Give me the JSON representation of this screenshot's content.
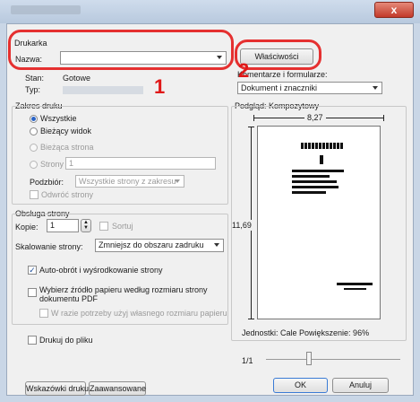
{
  "window": {
    "close_glyph": "x"
  },
  "printer": {
    "group_label": "Drukarka",
    "name_label": "Nazwa:",
    "status_label": "Stan:",
    "status_value": "Gotowe",
    "type_label": "Typ:",
    "properties_button": "Właściwości"
  },
  "comments": {
    "label": "Komentarze i formularze:",
    "selected": "Dokument i znaczniki"
  },
  "range": {
    "group_label": "Zakres druku",
    "all": "Wszystkie",
    "current_view": "Bieżący widok",
    "current_page": "Bieżąca strona",
    "pages": "Strony",
    "pages_value": "1",
    "subset_label": "Podzbiór:",
    "subset_value": "Wszystkie strony z zakresu",
    "reverse": "Odwróć strony"
  },
  "handling": {
    "group_label": "Obsługa strony",
    "copies_label": "Kopie:",
    "copies_value": "1",
    "collate": "Sortuj",
    "scaling_label": "Skalowanie strony:",
    "scaling_value": "Zmniejsz do obszaru zadruku",
    "auto_rotate": "Auto-obrót i wyśrodkowanie strony",
    "paper_source_line1": "Wybierz źródło papieru według rozmiaru strony",
    "paper_source_line2": "dokumentu PDF",
    "custom_size": "W razie potrzeby użyj własnego rozmiaru papieru"
  },
  "print_to_file": "Drukuj do pliku",
  "preview": {
    "label": "Podgląd: Kompozytowy",
    "width": "8,27",
    "height": "11,69",
    "units": "Jednostki: Cale Powiększenie:  96%",
    "page_indicator": "1/1"
  },
  "buttons": {
    "hints": "Wskazówki druku",
    "advanced": "Zaawansowane",
    "ok": "OK",
    "cancel": "Anuluj"
  },
  "annotations": {
    "one": "1",
    "two": "2"
  }
}
